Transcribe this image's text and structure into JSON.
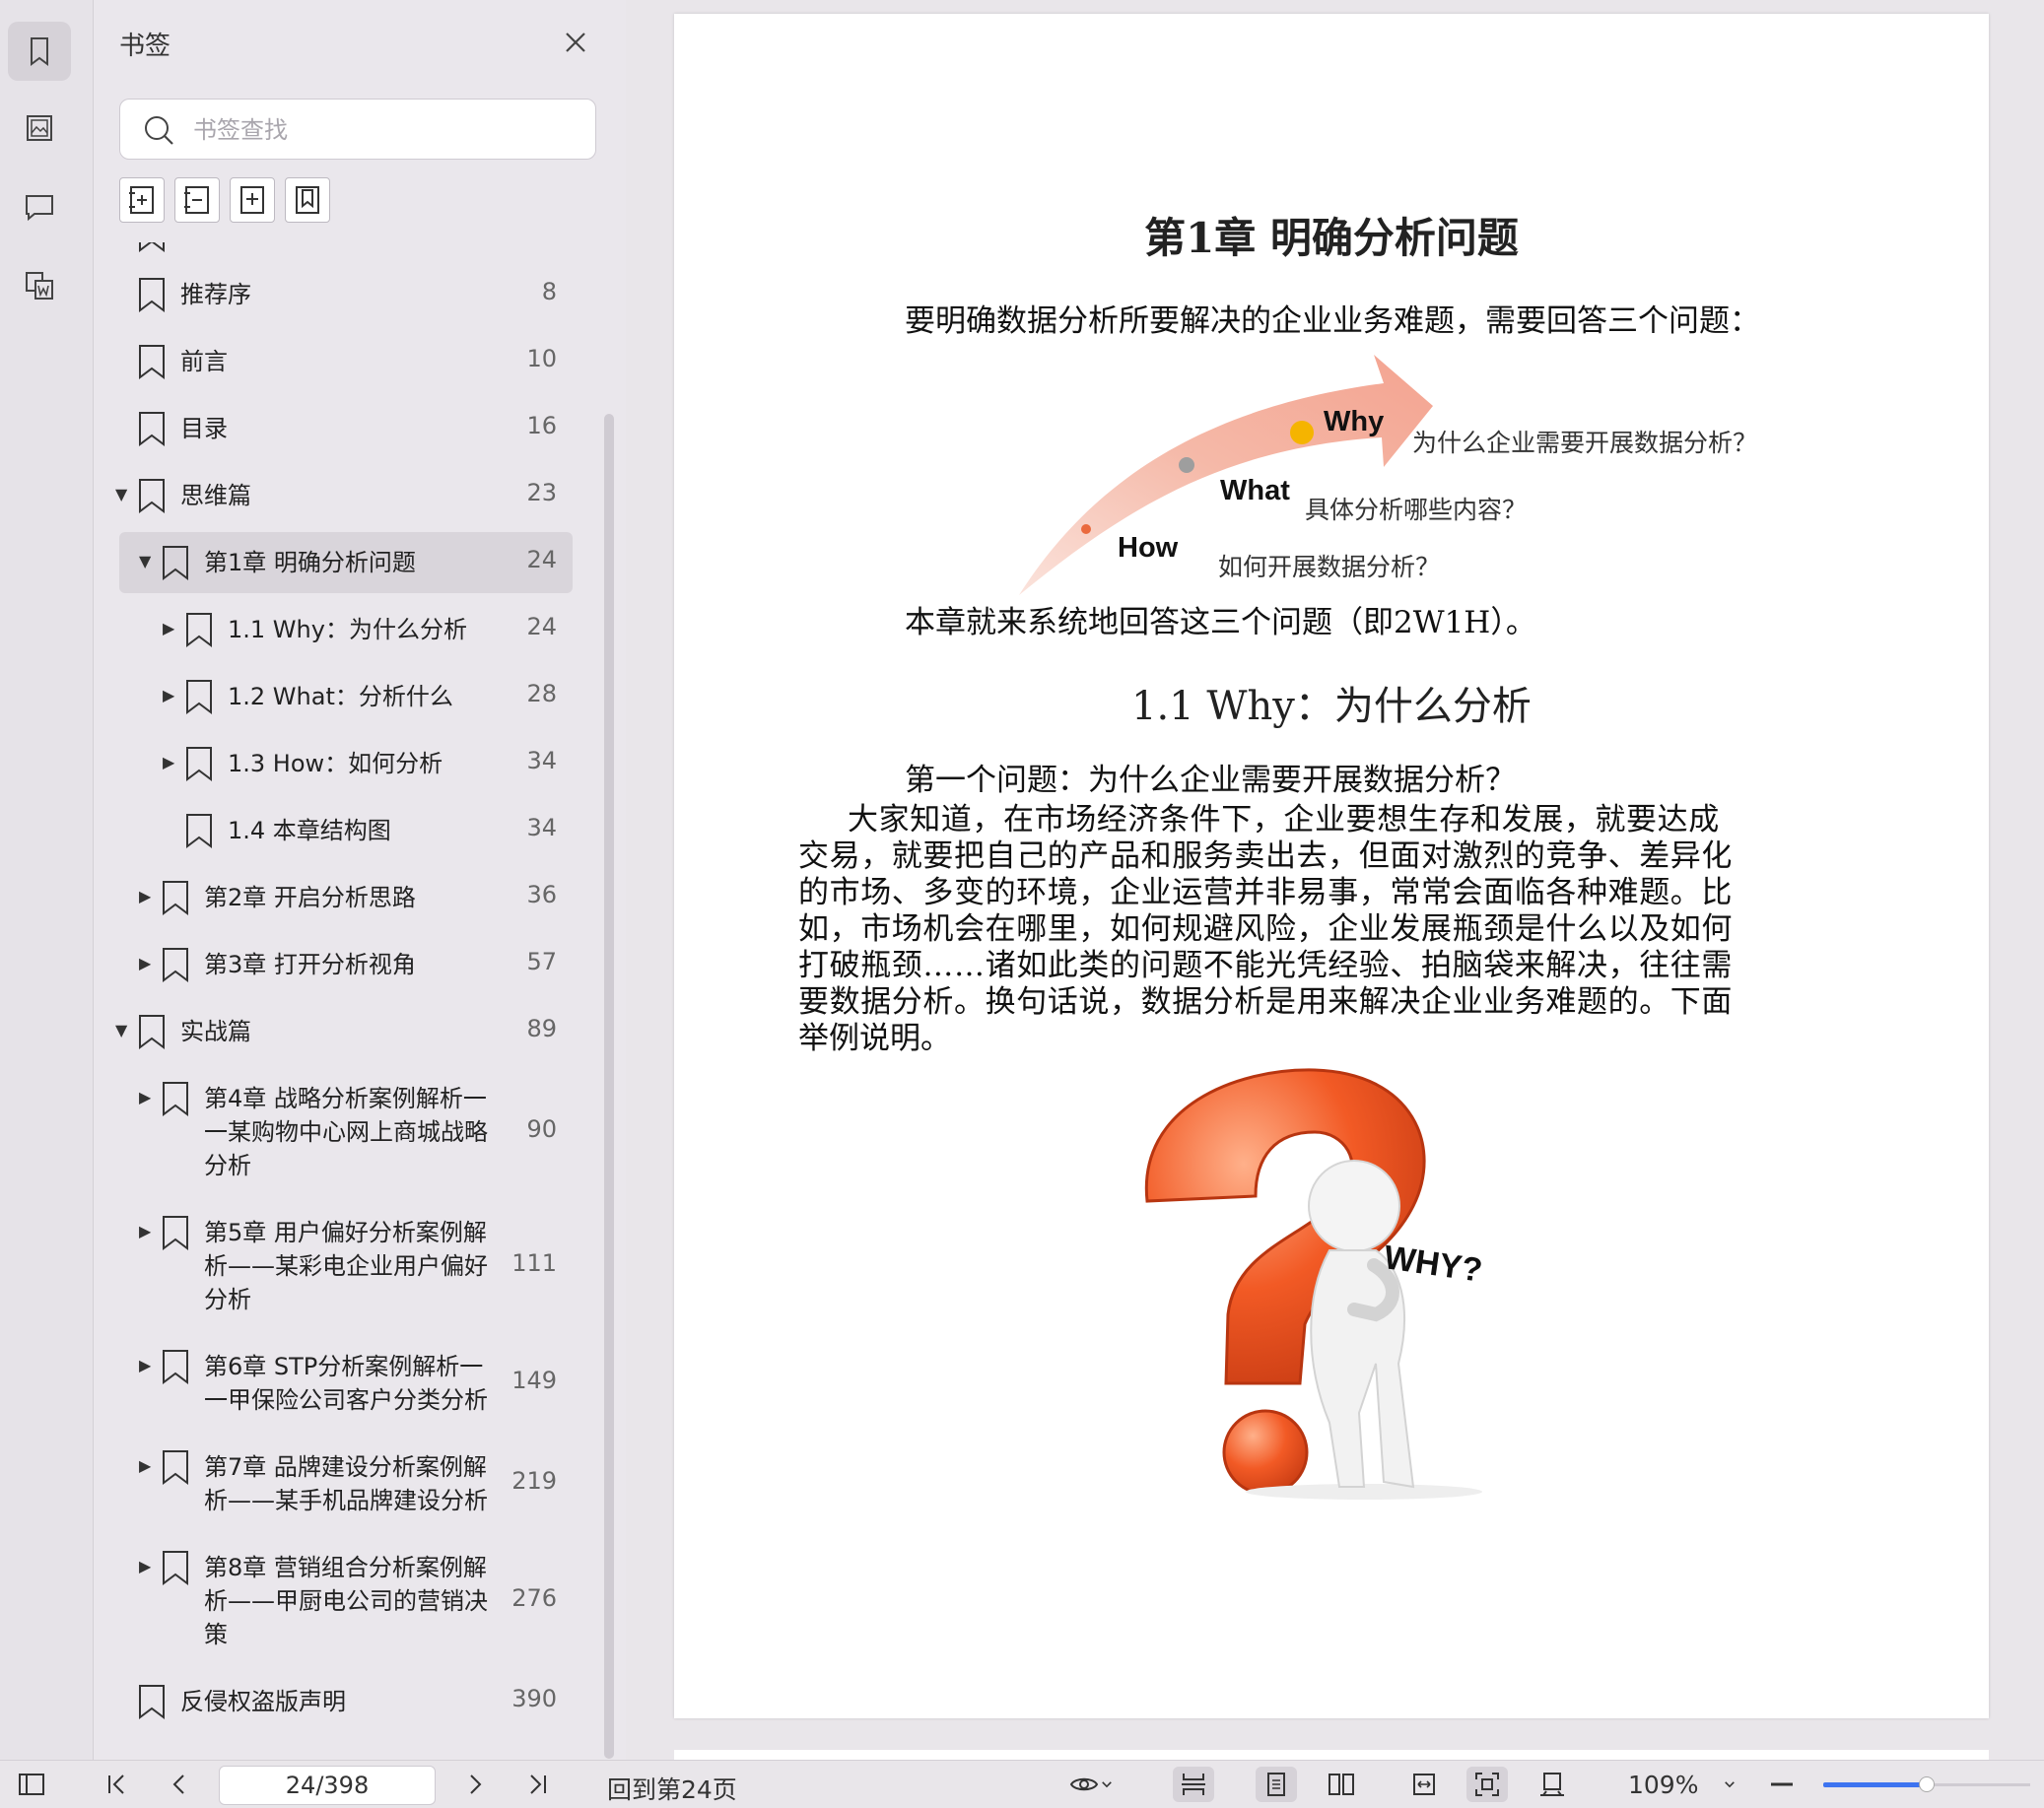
{
  "panel": {
    "title": "书签",
    "search_placeholder": "书签查找"
  },
  "bookmarks": [
    {
      "label": "推荐序",
      "page": "8"
    },
    {
      "label": "前言",
      "page": "10"
    },
    {
      "label": "目录",
      "page": "16"
    },
    {
      "label": "思维篇",
      "page": "23"
    },
    {
      "label": "第1章 明确分析问题",
      "page": "24"
    },
    {
      "label": "1.1 Why：为什么分析",
      "page": "24"
    },
    {
      "label": "1.2 What：分析什么",
      "page": "28"
    },
    {
      "label": "1.3 How：如何分析",
      "page": "34"
    },
    {
      "label": "1.4 本章结构图",
      "page": "34"
    },
    {
      "label": "第2章 开启分析思路",
      "page": "36"
    },
    {
      "label": "第3章 打开分析视角",
      "page": "57"
    },
    {
      "label": "实战篇",
      "page": "89"
    },
    {
      "label_lines": [
        "第4章 战略分析案例解析一",
        "一某购物中心网上商城战略",
        "分析"
      ],
      "page": "90"
    },
    {
      "label_lines": [
        "第5章 用户偏好分析案例解",
        "析——某彩电企业用户偏好",
        "分析"
      ],
      "page": "111"
    },
    {
      "label_lines": [
        "第6章 STP分析案例解析一",
        "一甲保险公司客户分类分析"
      ],
      "page": "149"
    },
    {
      "label_lines": [
        "第7章 品牌建设分析案例解",
        "析——某手机品牌建设分析"
      ],
      "page": "219"
    },
    {
      "label_lines": [
        "第8章 营销组合分析案例解",
        "析——甲厨电公司的营销决",
        "策"
      ],
      "page": "276"
    },
    {
      "label": "反侵权盗版声明",
      "page": "390"
    }
  ],
  "document": {
    "chapter_title": "第1章  明确分析问题",
    "intro": "要明确数据分析所要解决的企业业务难题，需要回答三个问题：",
    "figure": {
      "why_key": "Why",
      "why_text": "为什么企业需要开展数据分析？",
      "what_key": "What",
      "what_text": "具体分析哪些内容？",
      "how_key": "How",
      "how_text": "如何开展数据分析？"
    },
    "summary": "本章就来系统地回答这三个问题（即2W1H）。",
    "section_title": "1.1  Why：为什么分析",
    "question": "第一个问题：为什么企业需要开展数据分析？",
    "body_lines": [
      "大家知道，在市场经济条件下，企业要想生存和发展，就要达成",
      "交易，就要把自己的产品和服务卖出去，但面对激烈的竞争、差异化",
      "的市场、多变的环境，企业运营并非易事，常常会面临各种难题。比",
      "如，市场机会在哪里，如何规避风险，企业发展瓶颈是什么以及如何",
      "打破瓶颈……诸如此类的问题不能光凭经验、拍脑袋来解决，往往需",
      "要数据分析。换句话说，数据分析是用来解决企业业务难题的。下面",
      "举例说明。"
    ],
    "illustration_text": "WHY?"
  },
  "statusbar": {
    "page_value": "24/398",
    "goto_text": "回到第24页",
    "zoom": "109%",
    "zoom_level": 0.5
  }
}
